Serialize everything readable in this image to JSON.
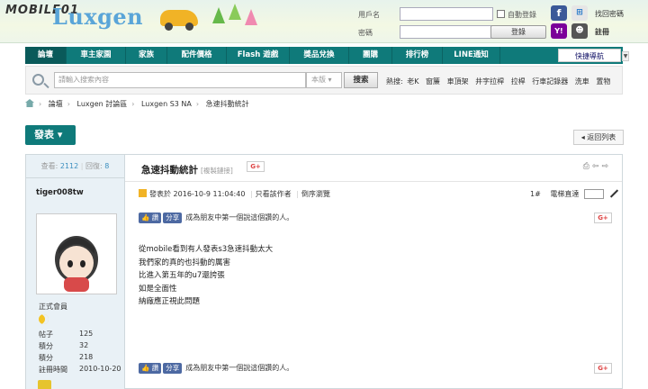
{
  "site": {
    "logo_text": "MOBILE01",
    "brand": "Luxgen"
  },
  "login": {
    "username_label": "用戶名",
    "password_label": "密碼",
    "auto_login": "自動登錄",
    "login_button": "登錄",
    "forgot": "找回密碼",
    "register": "註冊"
  },
  "nav": {
    "items": [
      "論壇",
      "車主家園",
      "家族",
      "配件價格",
      "Flash 遊戲",
      "獎品兌換",
      "團購",
      "排行榜",
      "LINE通知"
    ],
    "quick_nav": "快捷導航"
  },
  "search": {
    "placeholder": "請輸入搜索內容",
    "scope": "本版",
    "button": "搜索",
    "hot_label": "熱搜:",
    "hot_terms": [
      "老K",
      "窗簾",
      "車頂架",
      "井字拉桿",
      "拉桿",
      "行車記錄器",
      "洗車",
      "置物"
    ]
  },
  "breadcrumb": [
    "論壇",
    "Luxgen 討論區",
    "Luxgen S3 NA",
    "急速抖動統計"
  ],
  "actions": {
    "post": "發表",
    "back": "返回列表"
  },
  "thread": {
    "views_label": "查看:",
    "views": "2112",
    "replies_label": "回復:",
    "replies": "8",
    "title": "急速抖動統計",
    "copy_link": "[複製鏈接]",
    "gplus": "G+"
  },
  "author": {
    "name": "tiger008tw",
    "rank": "正式會員",
    "stats": [
      {
        "label": "帖子",
        "value": "125"
      },
      {
        "label": "積分",
        "value": "32"
      },
      {
        "label": "積分",
        "value": "218"
      },
      {
        "label": "註冊時間",
        "value": "2010-10-20"
      }
    ]
  },
  "post": {
    "posted_label": "發表於",
    "posted_time": "2016-10-9 11:04:40",
    "only_author": "只看該作者",
    "reverse": "倒序瀏覽",
    "floor": "1#",
    "jump_label": "電梯直達",
    "like": "讚",
    "share": "分享",
    "like_prompt": "成為朋友中第一個說這個讚的人。",
    "lines": [
      "從mobile看到有人發表s3急速抖動太大",
      "我們家的真的也抖動的厲害",
      "比進入第五年的u7還誇張",
      "如是全面性",
      "納廠應正視此問題"
    ]
  }
}
